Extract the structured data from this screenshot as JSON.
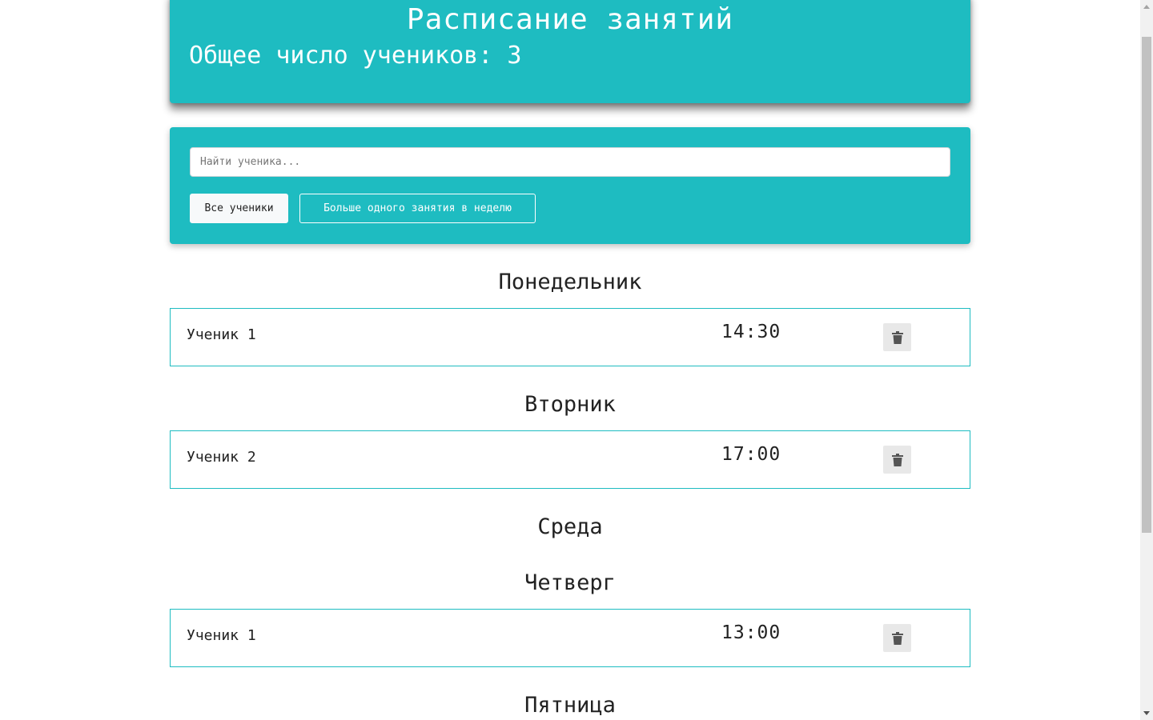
{
  "header": {
    "title": "Расписание занятий",
    "count_text": "Общее число учеников: 3"
  },
  "search": {
    "placeholder": "Найти ученика..."
  },
  "filters": {
    "all_label": "Все ученики",
    "more_label": "Больше одного занятия в неделю"
  },
  "days": [
    {
      "name": "Понедельник",
      "lessons": [
        {
          "student": "Ученик 1",
          "time": "14:30"
        }
      ]
    },
    {
      "name": "Вторник",
      "lessons": [
        {
          "student": "Ученик 2",
          "time": "17:00"
        }
      ]
    },
    {
      "name": "Среда",
      "lessons": []
    },
    {
      "name": "Четверг",
      "lessons": [
        {
          "student": "Ученик 1",
          "time": "13:00"
        }
      ]
    },
    {
      "name": "Пятница",
      "lessons": []
    }
  ],
  "colors": {
    "accent": "#1ebcc1",
    "text": "#222222"
  },
  "icons": {
    "delete": "trash-icon"
  }
}
